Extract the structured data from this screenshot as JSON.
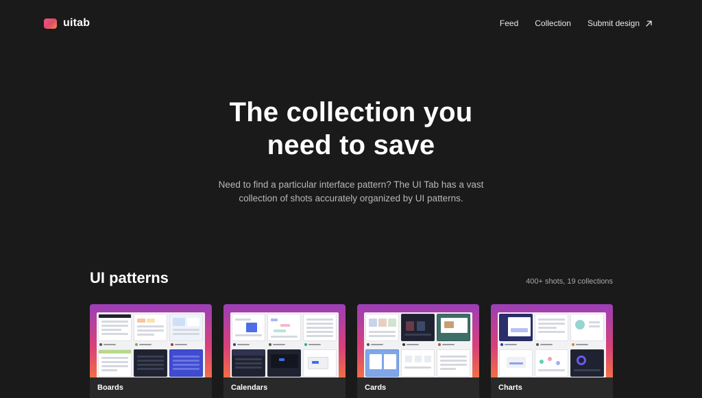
{
  "header": {
    "logo_text": "uitab",
    "nav": [
      {
        "label": "Feed"
      },
      {
        "label": "Collection"
      },
      {
        "label": "Submit design"
      }
    ]
  },
  "hero": {
    "title_line1": "The collection you",
    "title_line2": "need to save",
    "subtitle_line1": "Need to find a particular interface pattern? The UI Tab has a vast",
    "subtitle_line2": "collection of shots accurately organized by UI patterns."
  },
  "section": {
    "title": "UI patterns",
    "meta": "400+ shots, 19 collections"
  },
  "cards": [
    {
      "label": "Boards"
    },
    {
      "label": "Calendars"
    },
    {
      "label": "Cards"
    },
    {
      "label": "Charts"
    }
  ],
  "colors": {
    "background": "#1b1a1a",
    "card_gradient_top": "#9a3fb8",
    "card_gradient_bottom": "#f4a040",
    "logo_accent": "#f0558a"
  },
  "icons": {
    "submit_arrow": "arrow-up-right-icon"
  }
}
